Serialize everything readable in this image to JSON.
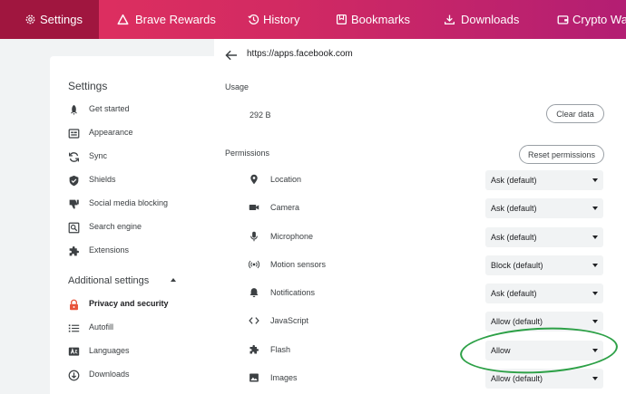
{
  "tabs": [
    {
      "label": "Settings",
      "icon": "gear-icon",
      "active": true
    },
    {
      "label": "Brave Rewards",
      "icon": "triangle-icon"
    },
    {
      "label": "History",
      "icon": "history-icon"
    },
    {
      "label": "Bookmarks",
      "icon": "bookmark-icon"
    },
    {
      "label": "Downloads",
      "icon": "download-icon"
    },
    {
      "label": "Crypto Wal",
      "icon": "wallet-icon"
    }
  ],
  "sidebar": {
    "title": "Settings",
    "items": [
      {
        "label": "Get started",
        "icon": "rocket-icon"
      },
      {
        "label": "Appearance",
        "icon": "appearance-icon"
      },
      {
        "label": "Sync",
        "icon": "sync-icon"
      },
      {
        "label": "Shields",
        "icon": "shield-icon"
      },
      {
        "label": "Social media blocking",
        "icon": "thumbs-down-icon"
      },
      {
        "label": "Search engine",
        "icon": "search-icon"
      },
      {
        "label": "Extensions",
        "icon": "puzzle-icon"
      }
    ],
    "advanced_title": "Additional settings",
    "advanced_items": [
      {
        "label": "Privacy and security",
        "icon": "lock-icon",
        "active": true
      },
      {
        "label": "Autofill",
        "icon": "list-icon"
      },
      {
        "label": "Languages",
        "icon": "language-icon"
      },
      {
        "label": "Downloads",
        "icon": "download-circle-icon"
      }
    ]
  },
  "main": {
    "url": "https://apps.facebook.com",
    "usage_title": "Usage",
    "usage_value": "292 B",
    "clear_label": "Clear data",
    "permissions_title": "Permissions",
    "reset_label": "Reset permissions",
    "permissions": [
      {
        "label": "Location",
        "value": "Ask (default)",
        "icon": "location-icon"
      },
      {
        "label": "Camera",
        "value": "Ask (default)",
        "icon": "camera-icon"
      },
      {
        "label": "Microphone",
        "value": "Ask (default)",
        "icon": "microphone-icon"
      },
      {
        "label": "Motion sensors",
        "value": "Block (default)",
        "icon": "sensors-icon"
      },
      {
        "label": "Notifications",
        "value": "Ask (default)",
        "icon": "bell-icon"
      },
      {
        "label": "JavaScript",
        "value": "Allow (default)",
        "icon": "code-icon"
      },
      {
        "label": "Flash",
        "value": "Allow",
        "icon": "puzzle-icon"
      },
      {
        "label": "Images",
        "value": "Allow (default)",
        "icon": "image-icon"
      }
    ]
  },
  "colors": {
    "tabbar_start": "#e2315f",
    "tabbar_end": "#b31e73",
    "active_tab": "#a0163f",
    "highlight_ellipse": "#2ca046"
  }
}
